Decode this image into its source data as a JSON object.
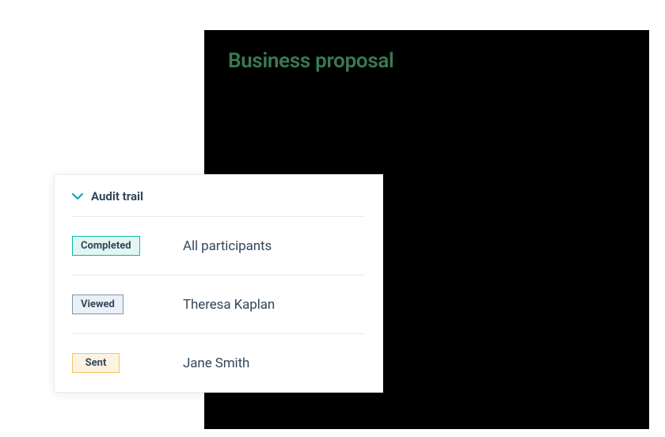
{
  "document": {
    "title": "Business proposal"
  },
  "audit": {
    "title": "Audit trail",
    "rows": [
      {
        "status": "Completed",
        "participant": "All participants",
        "badge_bg": "#e5f5f1",
        "badge_border": "#00bda5",
        "badge_text_color": "#33475b"
      },
      {
        "status": "Viewed",
        "participant": "Theresa Kaplan",
        "badge_bg": "#eaf0f6",
        "badge_border": "#7c98b6",
        "badge_text_color": "#33475b"
      },
      {
        "status": "Sent",
        "participant": "Jane Smith",
        "badge_bg": "#fdf3e1",
        "badge_border": "#f5c26b",
        "badge_text_color": "#33475b"
      }
    ]
  }
}
